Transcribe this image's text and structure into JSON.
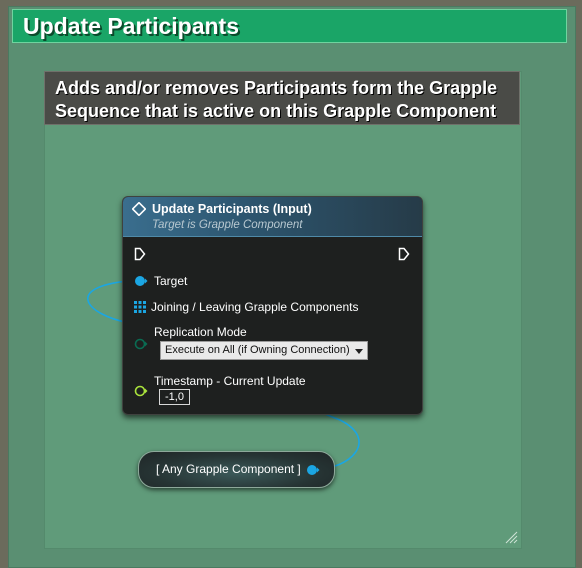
{
  "outer_comment": {
    "title": "Update Participants"
  },
  "inner_comment": {
    "title": "Adds and/or removes Participants form the Grapple Sequence that is active on this Grapple Component"
  },
  "function_node": {
    "title": "Update Participants (Input)",
    "subtitle": "Target is Grapple Component",
    "pins": {
      "target_label": "Target",
      "components_label": "Joining / Leaving Grapple Components",
      "replication_label": "Replication Mode",
      "replication_value": "Execute on All (if Owning Connection)",
      "timestamp_label": "Timestamp - Current Update",
      "timestamp_value": "-1,0"
    }
  },
  "get_node": {
    "label": "[ Any Grapple Component ]"
  },
  "colors": {
    "outer_header": "#1aa567",
    "object_pin": "#1ba6e3",
    "enum_pin": "#0a5a46",
    "float_pin": "#a9e23c",
    "wire": "#1ba6e3"
  }
}
